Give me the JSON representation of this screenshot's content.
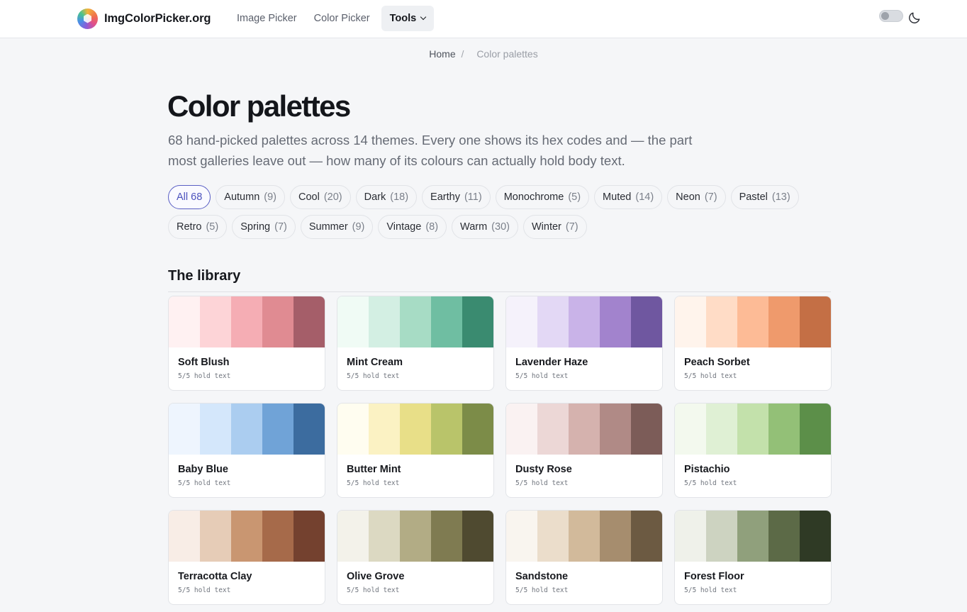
{
  "header": {
    "brand": "ImgColorPicker.org",
    "nav": [
      {
        "label": "Image Picker"
      },
      {
        "label": "Color Picker"
      },
      {
        "label": "Tools"
      }
    ]
  },
  "breadcrumb": {
    "home": "Home",
    "separator": "/",
    "current": "Color palettes"
  },
  "hero": {
    "title": "Color palettes",
    "intro": "68 hand-picked palettes across 14 themes. Every one shows its hex codes and — the part most galleries leave out — how many of its colours can actually hold body text."
  },
  "filters": [
    {
      "label": "All 68",
      "count": "",
      "active": true
    },
    {
      "label": "Autumn",
      "count": "(9)"
    },
    {
      "label": "Cool",
      "count": "(20)"
    },
    {
      "label": "Dark",
      "count": "(18)"
    },
    {
      "label": "Earthy",
      "count": "(11)"
    },
    {
      "label": "Monochrome",
      "count": "(5)"
    },
    {
      "label": "Muted",
      "count": "(14)"
    },
    {
      "label": "Neon",
      "count": "(7)"
    },
    {
      "label": "Pastel",
      "count": "(13)"
    },
    {
      "label": "Retro",
      "count": "(5)"
    },
    {
      "label": "Spring",
      "count": "(7)"
    },
    {
      "label": "Summer",
      "count": "(9)"
    },
    {
      "label": "Vintage",
      "count": "(8)"
    },
    {
      "label": "Warm",
      "count": "(30)"
    },
    {
      "label": "Winter",
      "count": "(7)"
    }
  ],
  "library": {
    "title": "The library",
    "palettes": [
      {
        "name": "Soft Blush",
        "meta": "5/5 hold text",
        "colors": [
          "#fff1f2",
          "#fdd4d7",
          "#f5adb4",
          "#e08b92",
          "#a55e69"
        ]
      },
      {
        "name": "Mint Cream",
        "meta": "5/5 hold text",
        "colors": [
          "#f0fbf5",
          "#d3efe3",
          "#a7dcc5",
          "#6fbea2",
          "#3a8b70"
        ]
      },
      {
        "name": "Lavender Haze",
        "meta": "5/5 hold text",
        "colors": [
          "#f5f2fb",
          "#e3d8f5",
          "#c9b3e8",
          "#a283cd",
          "#6f57a0"
        ]
      },
      {
        "name": "Peach Sorbet",
        "meta": "5/5 hold text",
        "colors": [
          "#fff4ec",
          "#ffdcc6",
          "#fdbb96",
          "#ef9a6c",
          "#c46f45"
        ]
      },
      {
        "name": "Baby Blue",
        "meta": "5/5 hold text",
        "colors": [
          "#eef5fe",
          "#d4e7fb",
          "#abcdf0",
          "#70a3d7",
          "#3c6c9f"
        ]
      },
      {
        "name": "Butter Mint",
        "meta": "5/5 hold text",
        "colors": [
          "#fffdf0",
          "#fbf2c3",
          "#e8df88",
          "#b9c46a",
          "#7c8c48"
        ]
      },
      {
        "name": "Dusty Rose",
        "meta": "5/5 hold text",
        "colors": [
          "#faf2f2",
          "#ecd7d6",
          "#d5b2ae",
          "#b08a86",
          "#7c5c58"
        ]
      },
      {
        "name": "Pistachio",
        "meta": "5/5 hold text",
        "colors": [
          "#f3f9ee",
          "#dff0d4",
          "#c3e1ab",
          "#93c077",
          "#5c8f49"
        ]
      },
      {
        "name": "Terracotta Clay",
        "meta": "5/5 hold text",
        "colors": [
          "#f8ede6",
          "#e6ccb7",
          "#c99671",
          "#a66a4a",
          "#74412f"
        ]
      },
      {
        "name": "Olive Grove",
        "meta": "5/5 hold text",
        "colors": [
          "#f3f2ea",
          "#dcd9c2",
          "#b2ac85",
          "#7f7b51",
          "#4f4a30"
        ]
      },
      {
        "name": "Sandstone",
        "meta": "5/5 hold text",
        "colors": [
          "#f9f5ef",
          "#ebddcb",
          "#d2ba9b",
          "#a68d6e",
          "#6c5a42"
        ]
      },
      {
        "name": "Forest Floor",
        "meta": "5/5 hold text",
        "colors": [
          "#eff1ea",
          "#cdd3c1",
          "#90a07c",
          "#5c6a47",
          "#2f3a25"
        ]
      }
    ]
  },
  "icons": {
    "theme_toggle": "toggle-switch",
    "dark_mode": "moon-icon",
    "brand_logo": "color-wheel-cube-logo",
    "dropdown": "chevron-down-icon"
  }
}
